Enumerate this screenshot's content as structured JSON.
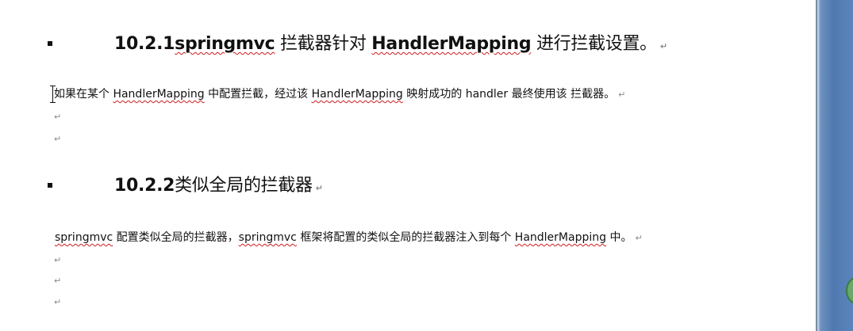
{
  "document": {
    "sections": [
      {
        "bullet": "▪",
        "heading_number": "10.2.1",
        "heading_parts": [
          "springmvc",
          " 拦截器针对 ",
          "HandlerMapping",
          " 进行拦截设置。"
        ],
        "body_parts": [
          "如果在某个 ",
          "HandlerMapping",
          " 中配置拦截，经过该  ",
          "HandlerMapping",
          " 映射成功的 handler 最终使用该  拦截器。"
        ]
      },
      {
        "bullet": "▪",
        "heading_number": "10.2.2",
        "heading_parts": [
          "类似全局的拦截器"
        ],
        "body_parts": [
          "springmvc",
          " 配置类似全局的拦截器，",
          "springmvc",
          " 框架将配置的类似全局的拦截器注入到每个 ",
          "HandlerMapping",
          " 中。"
        ]
      }
    ],
    "paragraph_mark": "↵"
  }
}
